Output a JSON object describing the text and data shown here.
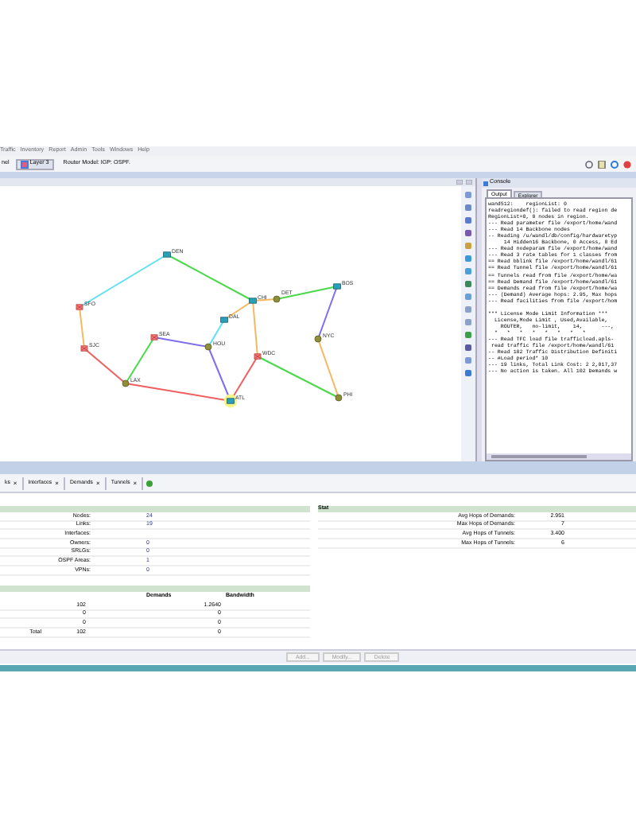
{
  "menu": [
    "Traffic",
    "Inventory",
    "Report",
    "Admin",
    "Tools",
    "Windows",
    "Help"
  ],
  "toolbar": {
    "partial_tab": "nel",
    "layer_button": "Layer 3",
    "router_model": "Router Model: IGP: OSPF."
  },
  "map": {
    "nodes": [
      {
        "label": "SFO",
        "kind": "switch",
        "selected": false
      },
      {
        "label": "DEN",
        "kind": "router",
        "selected": false
      },
      {
        "label": "CHI",
        "kind": "router",
        "selected": false
      },
      {
        "label": "DET",
        "kind": "site",
        "selected": false
      },
      {
        "label": "BOS",
        "kind": "router",
        "selected": false
      },
      {
        "label": "DAL",
        "kind": "router",
        "selected": false
      },
      {
        "label": "SJC",
        "kind": "switch",
        "selected": false
      },
      {
        "label": "SEA",
        "kind": "switch",
        "selected": false
      },
      {
        "label": "HOU",
        "kind": "site",
        "selected": false
      },
      {
        "label": "WDC",
        "kind": "switch",
        "selected": false
      },
      {
        "label": "NYC",
        "kind": "site",
        "selected": false
      },
      {
        "label": "LAX",
        "kind": "site",
        "selected": false
      },
      {
        "label": "ATL",
        "kind": "router",
        "selected": true
      },
      {
        "label": "PHI",
        "kind": "site",
        "selected": false
      }
    ],
    "links": [
      {
        "color": "#5ee0f0"
      },
      {
        "color": "#49d94a"
      },
      {
        "color": "#f5b860"
      },
      {
        "color": "#49d94a"
      },
      {
        "color": "#7f6df0"
      },
      {
        "color": "#f5b860"
      },
      {
        "color": "#5ee0f0"
      },
      {
        "color": "#f5b860"
      },
      {
        "color": "#f5b860"
      },
      {
        "color": "#ef5f5f"
      },
      {
        "color": "#49d94a"
      },
      {
        "color": "#7f6df0"
      },
      {
        "color": "#7f6df0"
      },
      {
        "color": "#ef5f5f"
      },
      {
        "color": "#ef5f5f"
      },
      {
        "color": "#49d94a"
      },
      {
        "color": "#f5b860"
      }
    ]
  },
  "console": {
    "title": "Console",
    "tabs": [
      {
        "label": "Output",
        "selected": true
      },
      {
        "label": "Explorer",
        "selected": false
      }
    ],
    "lines": [
      "wand512:    regionList: 0",
      "readregiondef(): failed to read region de",
      "RegionList=0, 0 nodes in region.",
      "--- Read parameter file /export/home/wand",
      "--- Read 14 Backbone nodes",
      "-- Reading /u/wandl/db/config/hardwaretyp",
      "     14 Hidden16 Backbone, 0 Access, 0 Ed",
      "--- Read nodeparam file /export/home/wand",
      "--- Read 3 rate tables for 1 classes from",
      "== Read bblink file /export/home/wandl/61",
      "== Read Tunnel file /export/home/wandl/61",
      "== Tunnels read from file /export/home/wa",
      "== Read Demand file /export/home/wandl/61",
      "== Demands read from file /export/home/wa",
      "--- (Demand) Average hops: 2.95, Max hops",
      "--- Read facilities from file /export/hom",
      "*** License Mode Limit Information ***",
      "  License,Mode Limit , Used,Available,",
      "    ROUTER,   no-limit,    14,      ---,",
      "  *   *   *   *   *   *   *   *",
      "--- Read TFC load file trafficload.apls-",
      " read traffic file /export/home/wandl/61",
      "-- Read 102 Traffic Distribution Definiti",
      "-- #Load period* 10",
      "--- 19 links, Total Link Cost: 2 2,017,37",
      "--- No action is taken. All 102 Demands w"
    ]
  },
  "bottom_tabs": [
    {
      "label": "ks",
      "close": "×"
    },
    {
      "label": "Interfaces",
      "close": "×"
    },
    {
      "label": "Demands",
      "close": "×"
    },
    {
      "label": "Tunnels",
      "close": "×"
    }
  ],
  "summary": [
    {
      "label": "Nodes:",
      "value": "24"
    },
    {
      "label": "Links:",
      "value": "19"
    },
    {
      "label": "Interfaces:"
    },
    {
      "label": "Owners:",
      "value": "0"
    },
    {
      "label": "SRLGs:",
      "value": "0"
    },
    {
      "label": "OSPF Areas:",
      "value": "1"
    },
    {
      "label": "VPNs:",
      "value": "0"
    }
  ],
  "demands": {
    "columns": [
      "Demands",
      "Bandwidth"
    ],
    "rows": [
      {
        "label": "",
        "count": "102",
        "value": "1.2640"
      },
      {
        "label": "",
        "count": "0",
        "value": "0"
      },
      {
        "label": "",
        "count": "0",
        "value": "0"
      },
      {
        "label": "Total",
        "count": "102",
        "value": "0"
      }
    ]
  },
  "stat": {
    "title": "Stat",
    "rows": [
      {
        "label": "Avg Hops of Demands:",
        "value": "2.951"
      },
      {
        "label": "Max Hops of Demands:",
        "value": "7"
      },
      {
        "label": "Avg Hops of Tunnels:",
        "value": "3.400"
      },
      {
        "label": "Max Hops of Tunnels:",
        "value": "6"
      }
    ]
  },
  "buttons": [
    "Add...",
    "Modify...",
    "Delete"
  ]
}
